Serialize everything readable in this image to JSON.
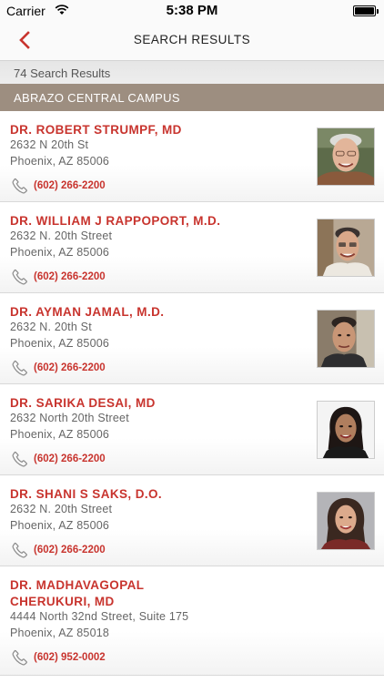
{
  "status": {
    "carrier": "Carrier",
    "time": "5:38 PM"
  },
  "nav": {
    "title": "SEARCH RESULTS"
  },
  "results_count": "74 Search Results",
  "section": {
    "title": "ABRAZO CENTRAL CAMPUS"
  },
  "colors": {
    "accent": "#c8342e",
    "section_bg": "#9d8e80"
  },
  "results": [
    {
      "name": "DR. ROBERT STRUMPF, MD",
      "address1": "2632 N 20th St",
      "address2": "Phoenix, AZ 85006",
      "phone": "(602) 266-2200"
    },
    {
      "name": "DR. WILLIAM J RAPPOPORT, M.D.",
      "address1": "2632 N. 20th Street",
      "address2": "Phoenix, AZ 85006",
      "phone": "(602) 266-2200"
    },
    {
      "name": "DR. AYMAN JAMAL, M.D.",
      "address1": "2632 N. 20th St",
      "address2": "Phoenix, AZ 85006",
      "phone": "(602) 266-2200"
    },
    {
      "name": "DR. SARIKA DESAI, MD",
      "address1": "2632 North 20th Street",
      "address2": "Phoenix, AZ 85006",
      "phone": "(602) 266-2200"
    },
    {
      "name": "DR. SHANI S SAKS, D.O.",
      "address1": "2632 N. 20th Street",
      "address2": "Phoenix, AZ 85006",
      "phone": "(602) 266-2200"
    },
    {
      "name_line1": "DR. MADHAVAGOPAL",
      "name_line2": "CHERUKURI, MD",
      "address1": "4444 North 32nd Street, Suite 175",
      "address2": "Phoenix, AZ 85018",
      "phone": "(602) 952-0002"
    }
  ]
}
